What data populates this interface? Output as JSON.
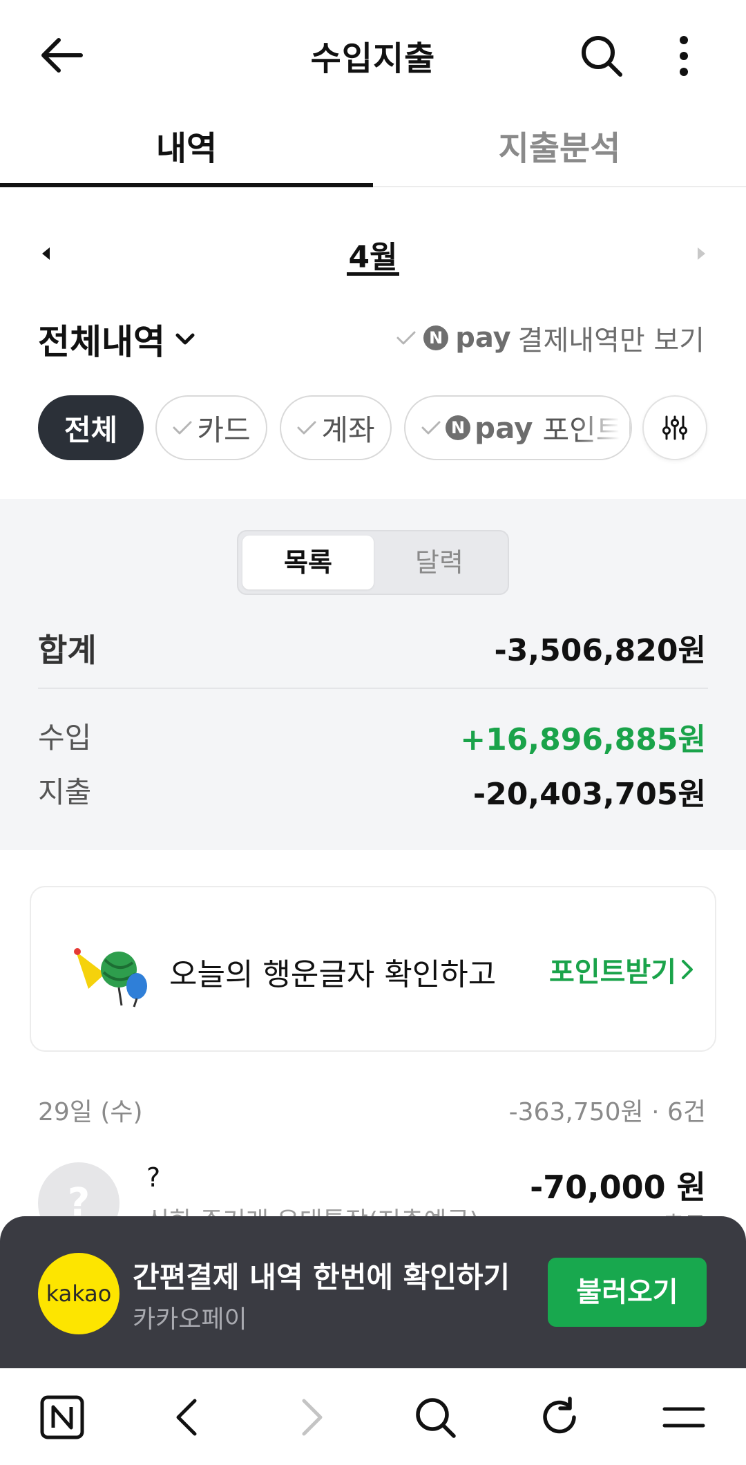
{
  "header": {
    "title": "수입지출",
    "back_icon": "arrow-left-icon",
    "search_icon": "search-icon",
    "more_icon": "more-vertical-icon"
  },
  "tabs": [
    {
      "label": "내역",
      "active": true
    },
    {
      "label": "지출분석",
      "active": false
    }
  ],
  "month_nav": {
    "label": "4월",
    "prev_icon": "caret-left-icon",
    "next_icon": "caret-right-icon"
  },
  "filter": {
    "dropdown_label": "전체내역",
    "npay_badge": "N",
    "npay_word": "pay",
    "npay_only_label": "결제내역만 보기"
  },
  "chips": {
    "all": "전체",
    "card": "카드",
    "account": "계좌",
    "npay_badge": "N",
    "npay_word": "pay",
    "npoint": "포인트"
  },
  "summary": {
    "view_toggle": {
      "list": "목록",
      "calendar": "달력"
    },
    "total_label": "합계",
    "total_value": "-3,506,820원",
    "income_label": "수입",
    "income_value": "+16,896,885원",
    "expense_label": "지출",
    "expense_value": "-20,403,705원"
  },
  "lucky_banner": {
    "text": "오늘의 행운글자 확인하고",
    "cta": "포인트받기"
  },
  "day_group": {
    "label": "29일 (수)",
    "summary": "-363,750원 · 6건"
  },
  "transaction": {
    "avatar": "?",
    "name": "?",
    "sub": "신한 주거래 우대통장(저축예금)",
    "amount": "-70,000 원",
    "type": "출금"
  },
  "promo": {
    "logo_text": "kakao",
    "title": "간편결제 내역 한번에 확인하기",
    "subtitle": "카카오페이",
    "button": "불러오기"
  },
  "browser_bar": {
    "icons": [
      "naver-home-icon",
      "back-icon",
      "forward-icon",
      "search-icon",
      "refresh-icon",
      "menu-icon"
    ]
  },
  "colors": {
    "accent_green": "#1aa34a",
    "chip_selected": "#2b3038",
    "promo_bg": "#3a3b42",
    "kakao_yellow": "#fde500",
    "button_green": "#18a84e"
  }
}
